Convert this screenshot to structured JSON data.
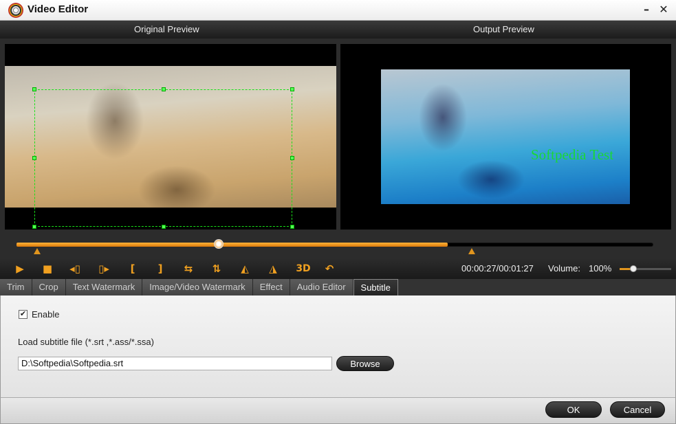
{
  "window": {
    "title": "Video Editor",
    "minimize_icon": "minimize-icon",
    "close_icon": "close-icon"
  },
  "preview": {
    "original_label": "Original Preview",
    "output_label": "Output Preview",
    "watermark_text": "Softpedia Test",
    "crop_color": "#18e018",
    "watermark_color": "#18d838"
  },
  "timeline": {
    "accent": "#e0951e"
  },
  "toolbar": {
    "tools": [
      {
        "name": "play-icon",
        "glyph": "▶"
      },
      {
        "name": "stop-icon",
        "glyph": "■"
      },
      {
        "name": "prev-frame-icon",
        "glyph": "◂▯"
      },
      {
        "name": "next-frame-icon",
        "glyph": "▯▸"
      },
      {
        "name": "mark-in-icon",
        "glyph": "["
      },
      {
        "name": "mark-out-icon",
        "glyph": "]"
      },
      {
        "name": "flip-horizontal-icon",
        "glyph": "⇆"
      },
      {
        "name": "flip-vertical-icon",
        "glyph": "⇅"
      },
      {
        "name": "rotate-left-icon",
        "glyph": "◭"
      },
      {
        "name": "rotate-right-icon",
        "glyph": "◮"
      },
      {
        "name": "3d-icon",
        "glyph": "3D"
      },
      {
        "name": "undo-icon",
        "glyph": "↶"
      }
    ],
    "time": "00:00:27/00:01:27",
    "volume_label": "Volume:",
    "volume_value": "100%",
    "volume_level": 0.26
  },
  "tabs": [
    {
      "label": "Trim",
      "active": false
    },
    {
      "label": "Crop",
      "active": false
    },
    {
      "label": "Text Watermark",
      "active": false
    },
    {
      "label": "Image/Video Watermark",
      "active": false
    },
    {
      "label": "Effect",
      "active": false
    },
    {
      "label": "Audio Editor",
      "active": false
    },
    {
      "label": "Subtitle",
      "active": true
    }
  ],
  "subtitle": {
    "enable_label": "Enable",
    "enable_checked": true,
    "load_label": "Load subtitle file (*.srt ,*.ass/*.ssa)",
    "file_path": "D:\\Softpedia\\Softpedia.srt",
    "browse_label": "Browse"
  },
  "footer": {
    "ok_label": "OK",
    "cancel_label": "Cancel"
  }
}
